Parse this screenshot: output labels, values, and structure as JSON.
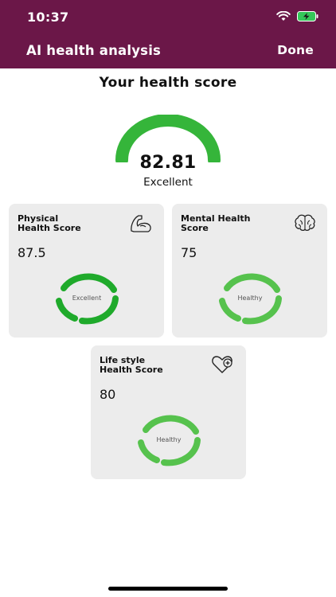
{
  "status_bar": {
    "time": "10:37"
  },
  "nav": {
    "title": "AI health analysis",
    "done_label": "Done"
  },
  "overall": {
    "heading": "Your health score",
    "value": "82.81",
    "rating": "Excellent",
    "gauge_fraction": 0.83
  },
  "cards": {
    "physical": {
      "title": "Physical\nHealth Score",
      "value": "87.5",
      "ring_label": "Excellent",
      "icon": "flexed-arm-icon",
      "ring_color": "#1faa2b"
    },
    "mental": {
      "title": "Mental Health\nScore",
      "value": "75",
      "ring_label": "Healthy",
      "icon": "brain-icon",
      "ring_color": "#56c24d"
    },
    "lifestyle": {
      "title": "Life style\nHealth Score",
      "value": "80",
      "ring_label": "Healthy",
      "icon": "heart-plus-icon",
      "ring_color": "#56c24d"
    }
  },
  "colors": {
    "header_bg": "#6b1748",
    "gauge_green": "#35b53a",
    "card_bg": "#ececec"
  }
}
